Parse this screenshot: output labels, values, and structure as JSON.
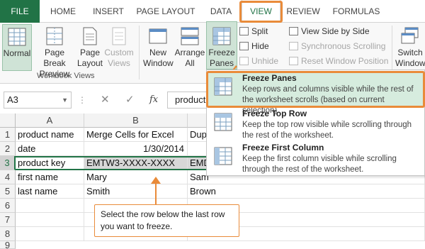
{
  "tabs": [
    {
      "label": "FILE"
    },
    {
      "label": "HOME"
    },
    {
      "label": "INSERT"
    },
    {
      "label": "PAGE LAYOUT"
    },
    {
      "label": "DATA"
    },
    {
      "label": "VIEW"
    },
    {
      "label": "REVIEW"
    },
    {
      "label": "FORMULAS"
    }
  ],
  "ribbon": {
    "workbook_views": {
      "label": "Workbook Views",
      "normal": "Normal",
      "page_break_1": "Page Break",
      "page_break_2": "Preview",
      "page_layout_1": "Page",
      "page_layout_2": "Layout",
      "custom_views_1": "Custom",
      "custom_views_2": "Views"
    },
    "window": {
      "new_window_1": "New",
      "new_window_2": "Window",
      "arrange_all_1": "Arrange",
      "arrange_all_2": "All",
      "freeze_panes_1": "Freeze",
      "freeze_panes_2": "Panes",
      "split": "Split",
      "hide": "Hide",
      "unhide": "Unhide",
      "view_side_by_side": "View Side by Side",
      "synchronous_scrolling": "Synchronous Scrolling",
      "reset_window_position": "Reset Window Position",
      "switch_windows_1": "Switch",
      "switch_windows_2": "Window"
    }
  },
  "formula_bar": {
    "name_box": "A3",
    "value": "product",
    "cancel_symbol": "✕",
    "enter_symbol": "✓",
    "fx_symbol": "fx"
  },
  "grid": {
    "columns": [
      "A",
      "B"
    ],
    "rows": [
      {
        "n": "1",
        "a": "product name",
        "b": "Merge Cells for Excel",
        "c": "Dup"
      },
      {
        "n": "2",
        "a": "date",
        "b": "1/30/2014",
        "c": ""
      },
      {
        "n": "3",
        "a": "product key",
        "b": "EMTW3-XXXX-XXXX",
        "c": "EMD"
      },
      {
        "n": "4",
        "a": "first name",
        "b": "Mary",
        "c": "Sam"
      },
      {
        "n": "5",
        "a": "last name",
        "b": "Smith",
        "c": "Brown"
      },
      {
        "n": "6",
        "a": "",
        "b": "",
        "c": ""
      },
      {
        "n": "7",
        "a": "",
        "b": "",
        "c": ""
      },
      {
        "n": "8",
        "a": "",
        "b": "",
        "c": ""
      },
      {
        "n": "9",
        "a": "",
        "b": "",
        "c": ""
      }
    ]
  },
  "menu": {
    "items": [
      {
        "title": "Freeze Panes",
        "desc": "Keep rows and columns visible while the rest of the worksheet scrolls (based on current selection)."
      },
      {
        "title": "Freeze Top Row",
        "desc": "Keep the top row visible while scrolling through the rest of the worksheet."
      },
      {
        "title": "Freeze First Column",
        "desc": "Keep the first column visible while scrolling through the rest of the worksheet."
      }
    ]
  },
  "callout": {
    "text": "Select the row below the last row you want to freeze."
  },
  "colors": {
    "excel_green": "#217346",
    "highlight_orange": "#e98b3a",
    "selection_fill": "#d7d7d7"
  }
}
